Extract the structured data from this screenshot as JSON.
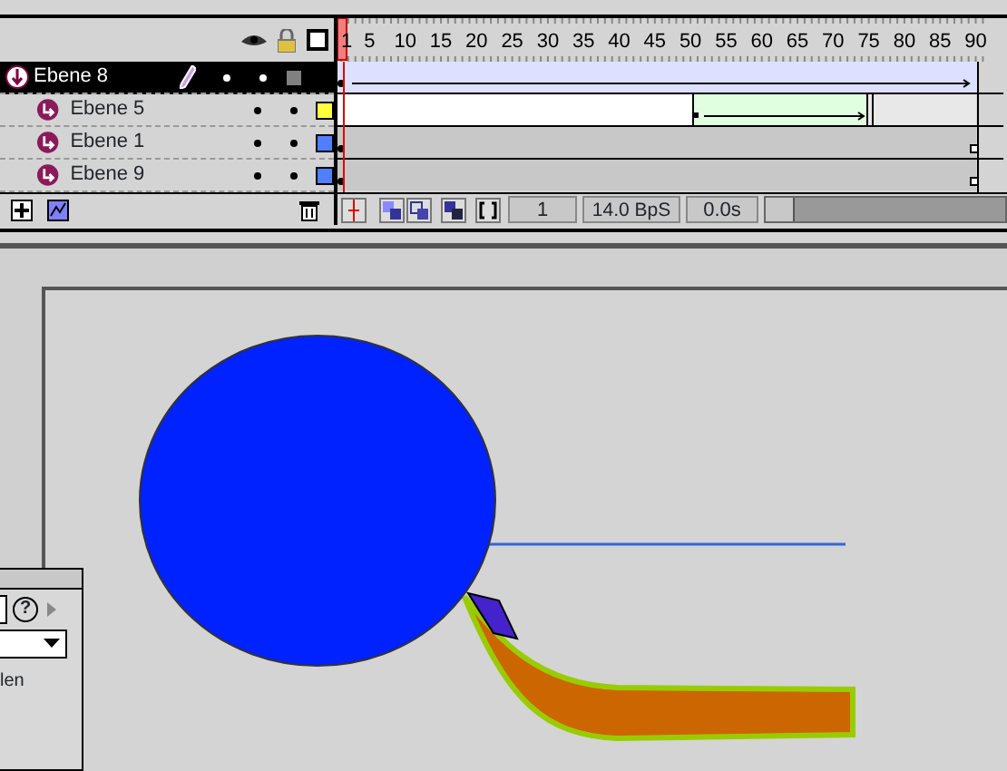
{
  "timeline": {
    "ruler": [
      "1",
      "5",
      "10",
      "15",
      "20",
      "25",
      "30",
      "35",
      "40",
      "45",
      "50",
      "55",
      "60",
      "65",
      "70",
      "75",
      "80",
      "85",
      "90"
    ],
    "layers": [
      {
        "name": "Ebene 8",
        "kind": "guide",
        "selected": true,
        "editing": true,
        "color": "#808080"
      },
      {
        "name": "Ebene 5",
        "kind": "guided",
        "selected": false,
        "editing": false,
        "color": "#ffff40"
      },
      {
        "name": "Ebene 1",
        "kind": "guided",
        "selected": false,
        "editing": false,
        "color": "#4f7fff"
      },
      {
        "name": "Ebene 9",
        "kind": "guided",
        "selected": false,
        "editing": false,
        "color": "#4f7fff"
      }
    ],
    "current_frame": "1",
    "frame_rate": "14.0 BpS",
    "elapsed": "0.0s"
  },
  "panel": {
    "help": "?",
    "text": "len"
  }
}
